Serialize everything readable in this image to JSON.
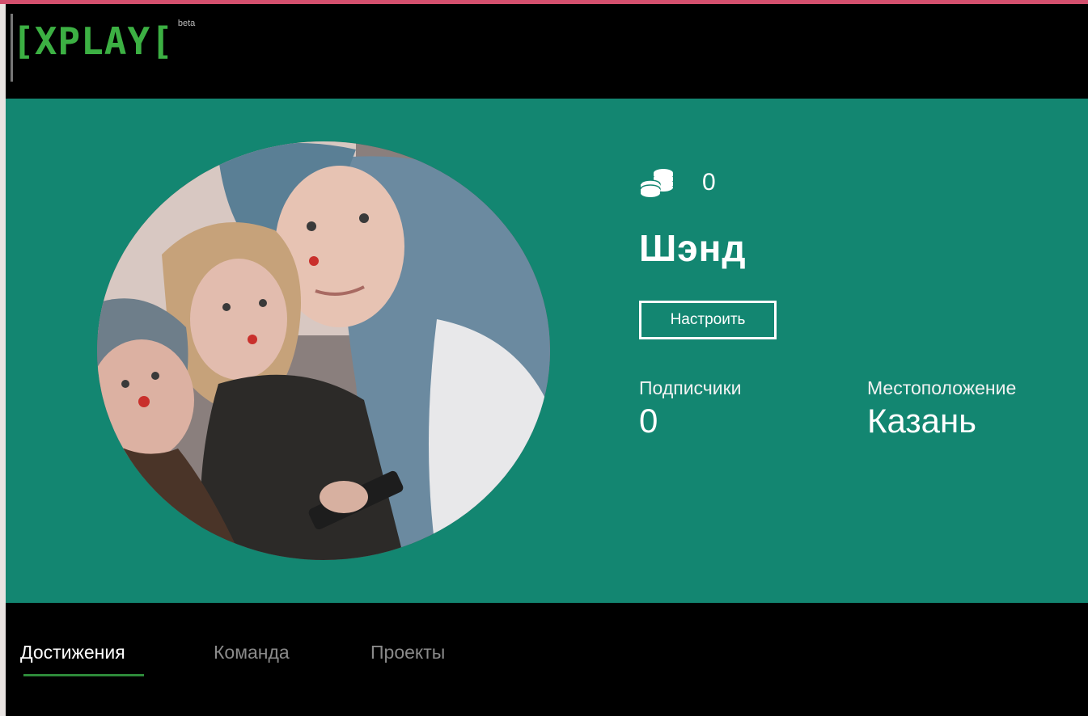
{
  "colors": {
    "accent_top_line": "#d4506e",
    "logo_green": "#3cb043",
    "hero_bg": "#138671",
    "tab_active_underline": "#2e8b3a"
  },
  "header": {
    "logo": "XPLAY",
    "logo_badge": "beta"
  },
  "profile": {
    "avatar_icon": "profile-photo",
    "coins_icon": "coins-stack-icon",
    "coins": "0",
    "username": "Шэнд",
    "settings_label": "Настроить",
    "followers_label": "Подписчики",
    "followers_value": "0",
    "location_label": "Местоположение",
    "location_value": "Казань"
  },
  "tabs": [
    {
      "label": "Достижения",
      "active": true
    },
    {
      "label": "Команда",
      "active": false
    },
    {
      "label": "Проекты",
      "active": false
    }
  ]
}
